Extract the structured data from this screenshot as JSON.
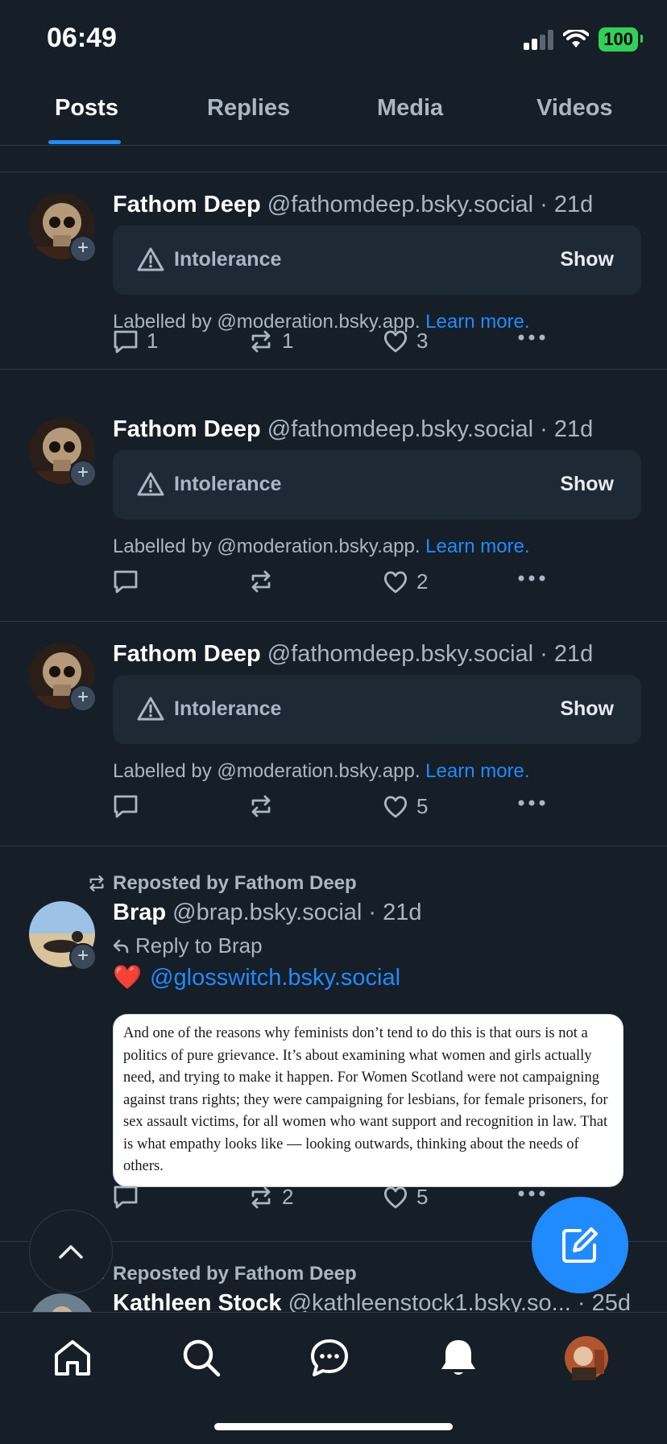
{
  "status_bar": {
    "time": "06:49",
    "battery": "100"
  },
  "tabs": [
    {
      "label": "Posts"
    },
    {
      "label": "Replies"
    },
    {
      "label": "Media"
    },
    {
      "label": "Videos"
    }
  ],
  "moderation": {
    "label": "Intolerance",
    "show": "Show",
    "labelled_by": "Labelled by @moderation.bsky.app.",
    "learn_more": "Learn more."
  },
  "posts": [
    {
      "author": "Fathom Deep",
      "handle": "@fathomdeep.bsky.social",
      "time": "· 21d",
      "replies": "1",
      "reposts": "1",
      "likes": "3"
    },
    {
      "author": "Fathom Deep",
      "handle": "@fathomdeep.bsky.social",
      "time": "· 21d",
      "replies": "",
      "reposts": "",
      "likes": "2"
    },
    {
      "author": "Fathom Deep",
      "handle": "@fathomdeep.bsky.social",
      "time": "· 21d",
      "replies": "",
      "reposts": "",
      "likes": "5"
    }
  ],
  "repost_post": {
    "reposted_by": "Reposted by Fathom Deep",
    "author": "Brap",
    "handle": "@brap.bsky.social",
    "time": "· 21d",
    "reply_to": "Reply to Brap",
    "text_emoji": "❤️",
    "mention": "@glosswitch.bsky.social",
    "image_text": "And one of the reasons why feminists don’t tend to do this is that ours is not a politics of pure grievance. It’s about examining what women and girls actually need, and trying to make it happen. For Women Scotland were not campaigning against trans rights; they were campaigning for lesbians, for female prisoners, for sex assault victims, for all women who want support and recognition in law. That is what empathy looks like — looking outwards, thinking about the needs of others.",
    "replies": "",
    "reposts": "2",
    "likes": "5"
  },
  "next_post": {
    "reposted_by": "Reposted by Fathom Deep",
    "author": "Kathleen Stock",
    "handle": "@kathleenstock1.bsky.so...",
    "time": "· 25d"
  },
  "icons": {
    "colors": {
      "accent": "#208bfe",
      "background": "#161e27",
      "muted": "#aab6c3",
      "card": "#1e2936"
    }
  }
}
